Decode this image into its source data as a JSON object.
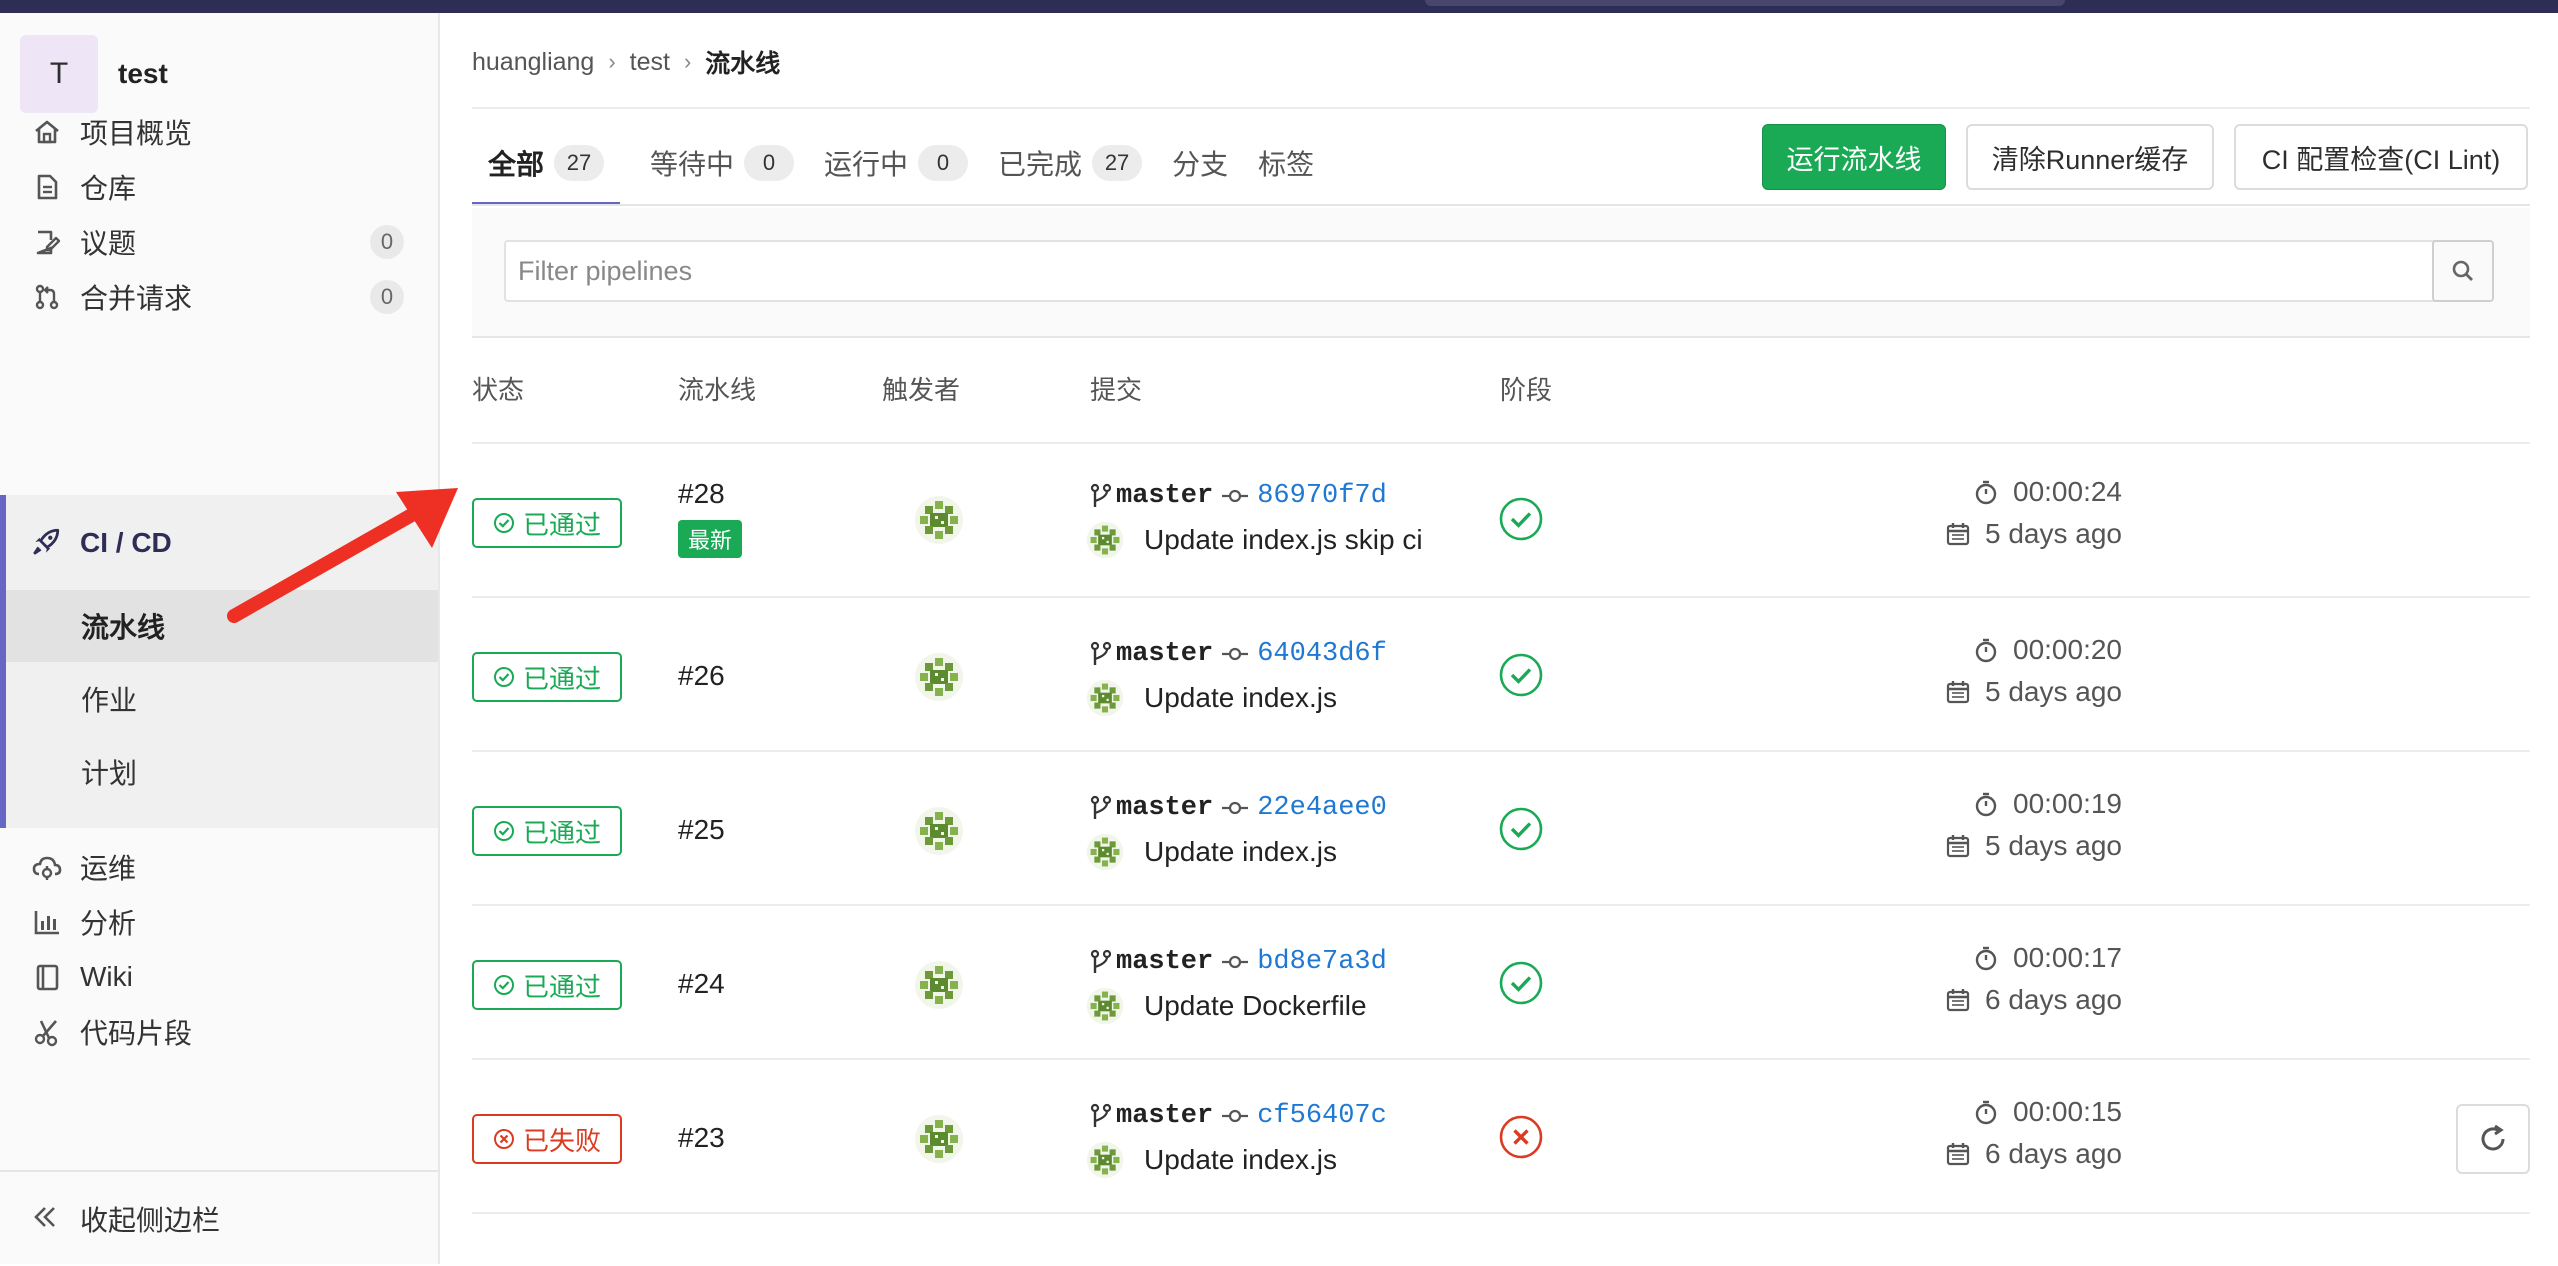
{
  "project": {
    "avatar_letter": "T",
    "name": "test"
  },
  "sidebar": {
    "items": [
      {
        "label": "项目概览",
        "icon": "home-icon"
      },
      {
        "label": "仓库",
        "icon": "document-icon"
      },
      {
        "label": "议题",
        "icon": "issues-icon",
        "count": "0"
      },
      {
        "label": "合并请求",
        "icon": "merge-request-icon",
        "count": "0"
      }
    ],
    "cicd": {
      "label": "CI / CD",
      "icon": "rocket-icon",
      "sub_items": [
        {
          "label": "流水线",
          "active": true
        },
        {
          "label": "作业"
        },
        {
          "label": "计划"
        }
      ]
    },
    "items_after": [
      {
        "label": "运维",
        "icon": "cloud-gear-icon"
      },
      {
        "label": "分析",
        "icon": "chart-icon"
      },
      {
        "label": "Wiki",
        "icon": "book-icon"
      },
      {
        "label": "代码片段",
        "icon": "scissors-icon"
      }
    ],
    "collapse_label": "收起侧边栏"
  },
  "breadcrumb": [
    "huangliang",
    "test",
    "流水线"
  ],
  "tabs": [
    {
      "label": "全部",
      "count": "27",
      "active": true
    },
    {
      "label": "等待中",
      "count": "0"
    },
    {
      "label": "运行中",
      "count": "0"
    },
    {
      "label": "已完成",
      "count": "27"
    },
    {
      "label": "分支"
    },
    {
      "label": "标签"
    }
  ],
  "buttons": {
    "run": "运行流水线",
    "clear_cache": "清除Runner缓存",
    "lint": "CI 配置检查(CI Lint)"
  },
  "filter": {
    "placeholder": "Filter pipelines"
  },
  "table": {
    "headers": {
      "status": "状态",
      "pipeline": "流水线",
      "trigger": "触发者",
      "commit": "提交",
      "stages": "阶段"
    },
    "rows": [
      {
        "status": "已通过",
        "state": "passed",
        "id": "#28",
        "latest": "最新",
        "branch": "master",
        "sha": "86970f7d",
        "message": "Update index.js skip ci",
        "duration": "00:00:24",
        "finished": "5 days ago"
      },
      {
        "status": "已通过",
        "state": "passed",
        "id": "#26",
        "branch": "master",
        "sha": "64043d6f",
        "message": "Update index.js",
        "duration": "00:00:20",
        "finished": "5 days ago"
      },
      {
        "status": "已通过",
        "state": "passed",
        "id": "#25",
        "branch": "master",
        "sha": "22e4aee0",
        "message": "Update index.js",
        "duration": "00:00:19",
        "finished": "5 days ago"
      },
      {
        "status": "已通过",
        "state": "passed",
        "id": "#24",
        "branch": "master",
        "sha": "bd8e7a3d",
        "message": "Update Dockerfile",
        "duration": "00:00:17",
        "finished": "6 days ago"
      },
      {
        "status": "已失败",
        "state": "failed",
        "id": "#23",
        "branch": "master",
        "sha": "cf56407c",
        "message": "Update index.js",
        "duration": "00:00:15",
        "finished": "6 days ago"
      }
    ]
  },
  "colors": {
    "success": "#1aaa55",
    "danger": "#db3b21",
    "accent": "#6666c4",
    "link": "#1f78d1",
    "annotation_arrow": "#ee3024"
  }
}
